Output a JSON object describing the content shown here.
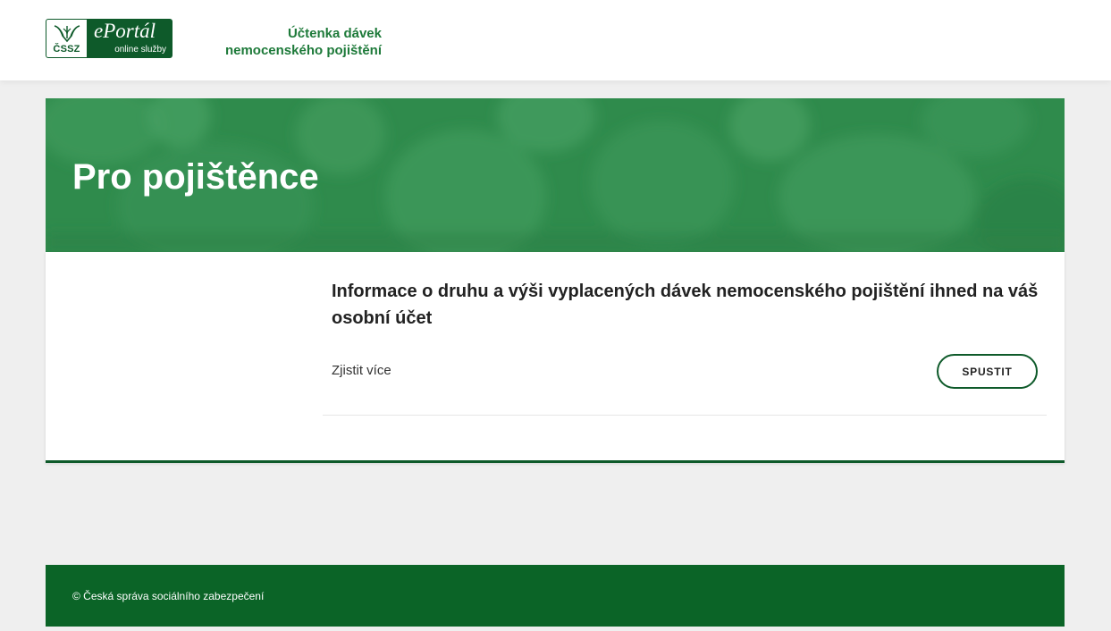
{
  "header": {
    "logo": {
      "org_abbr": "ČSSZ",
      "portal_name": "ePortál",
      "portal_sub": "online služby"
    },
    "app_title_line1": "Účtenka dávek",
    "app_title_line2": "nemocenského pojištění"
  },
  "hero": {
    "title": "Pro pojištěnce"
  },
  "service": {
    "title": "Informace o druhu a výši vyplacených dávek nemocenského pojištění ihned na váš osobní účet",
    "more_link": "Zjistit více",
    "run_button": "SPUSTIT"
  },
  "footer": {
    "copyright": "© Česká správa sociálního zabezpečení"
  },
  "colors": {
    "brand_dark_green": "#0e5a2a",
    "hero_green": "#2e8a4b",
    "title_green": "#1e7a3a",
    "footer_green": "#0b6427",
    "page_background": "#efefef"
  },
  "icons": {
    "logo_emblem": "cssz-emblem-icon"
  }
}
